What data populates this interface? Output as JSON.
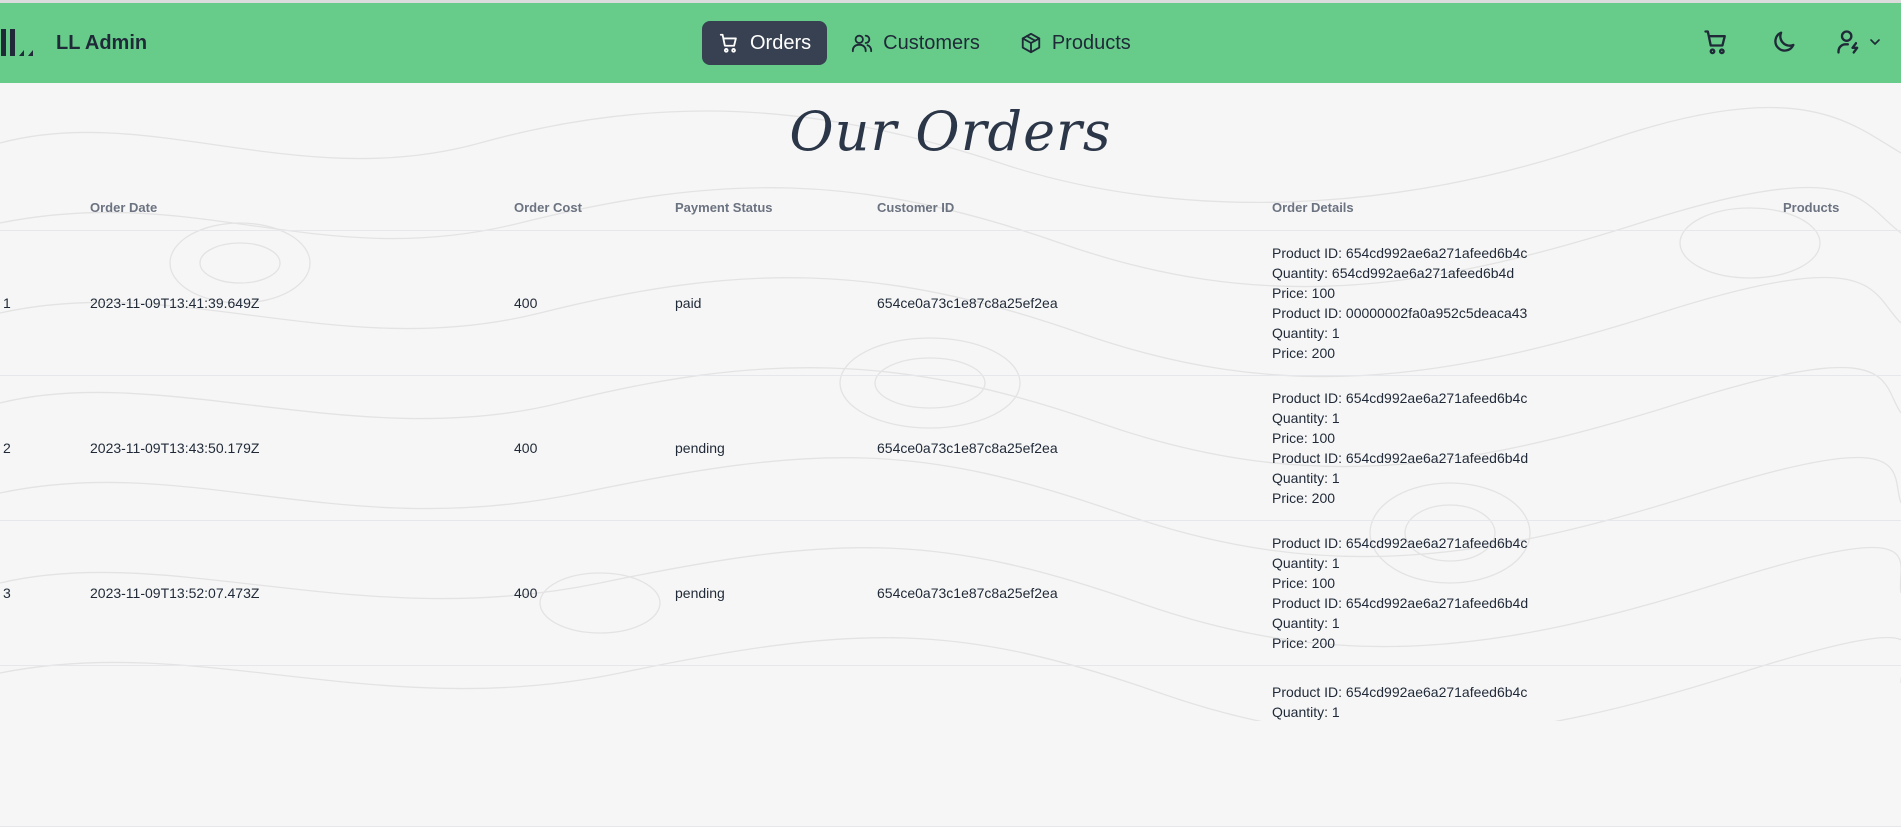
{
  "app": {
    "brand": "LL Admin"
  },
  "nav": {
    "items": [
      {
        "label": "Orders",
        "icon": "cart-icon",
        "active": true
      },
      {
        "label": "Customers",
        "icon": "users-icon",
        "active": false
      },
      {
        "label": "Products",
        "icon": "box-icon",
        "active": false
      }
    ],
    "right_icons": [
      "cart-icon",
      "moon-icon",
      "user-icon",
      "chevron-down-icon"
    ]
  },
  "page": {
    "title": "Our Orders"
  },
  "table": {
    "columns": [
      "",
      "Order Date",
      "Order Cost",
      "Payment Status",
      "Customer ID",
      "Order Details",
      "Products"
    ],
    "rows": [
      {
        "index": "1",
        "date": "2023-11-09T13:41:39.649Z",
        "cost": "400",
        "status": "paid",
        "customer": "654ce0a73c1e87c8a25ef2ea",
        "details": [
          "Product ID: 654cd992ae6a271afeed6b4c",
          "Quantity: 654cd992ae6a271afeed6b4d",
          "Price: 100",
          "Product ID: 00000002fa0a952c5deaca43",
          "Quantity: 1",
          "Price: 200"
        ]
      },
      {
        "index": "2",
        "date": "2023-11-09T13:43:50.179Z",
        "cost": "400",
        "status": "pending",
        "customer": "654ce0a73c1e87c8a25ef2ea",
        "details": [
          "Product ID: 654cd992ae6a271afeed6b4c",
          "Quantity: 1",
          "Price: 100",
          "Product ID: 654cd992ae6a271afeed6b4d",
          "Quantity: 1",
          "Price: 200"
        ]
      },
      {
        "index": "3",
        "date": "2023-11-09T13:52:07.473Z",
        "cost": "400",
        "status": "pending",
        "customer": "654ce0a73c1e87c8a25ef2ea",
        "details": [
          "Product ID: 654cd992ae6a271afeed6b4c",
          "Quantity: 1",
          "Price: 100",
          "Product ID: 654cd992ae6a271afeed6b4d",
          "Quantity: 1",
          "Price: 200"
        ]
      },
      {
        "index": "",
        "date": "",
        "cost": "",
        "status": "",
        "customer": "",
        "details": [
          "Product ID: 654cd992ae6a271afeed6b4c",
          "Quantity: 1"
        ]
      }
    ]
  },
  "colors": {
    "navbar": "#67cc8a",
    "active_nav": "#374151",
    "text": "#1f2937"
  }
}
